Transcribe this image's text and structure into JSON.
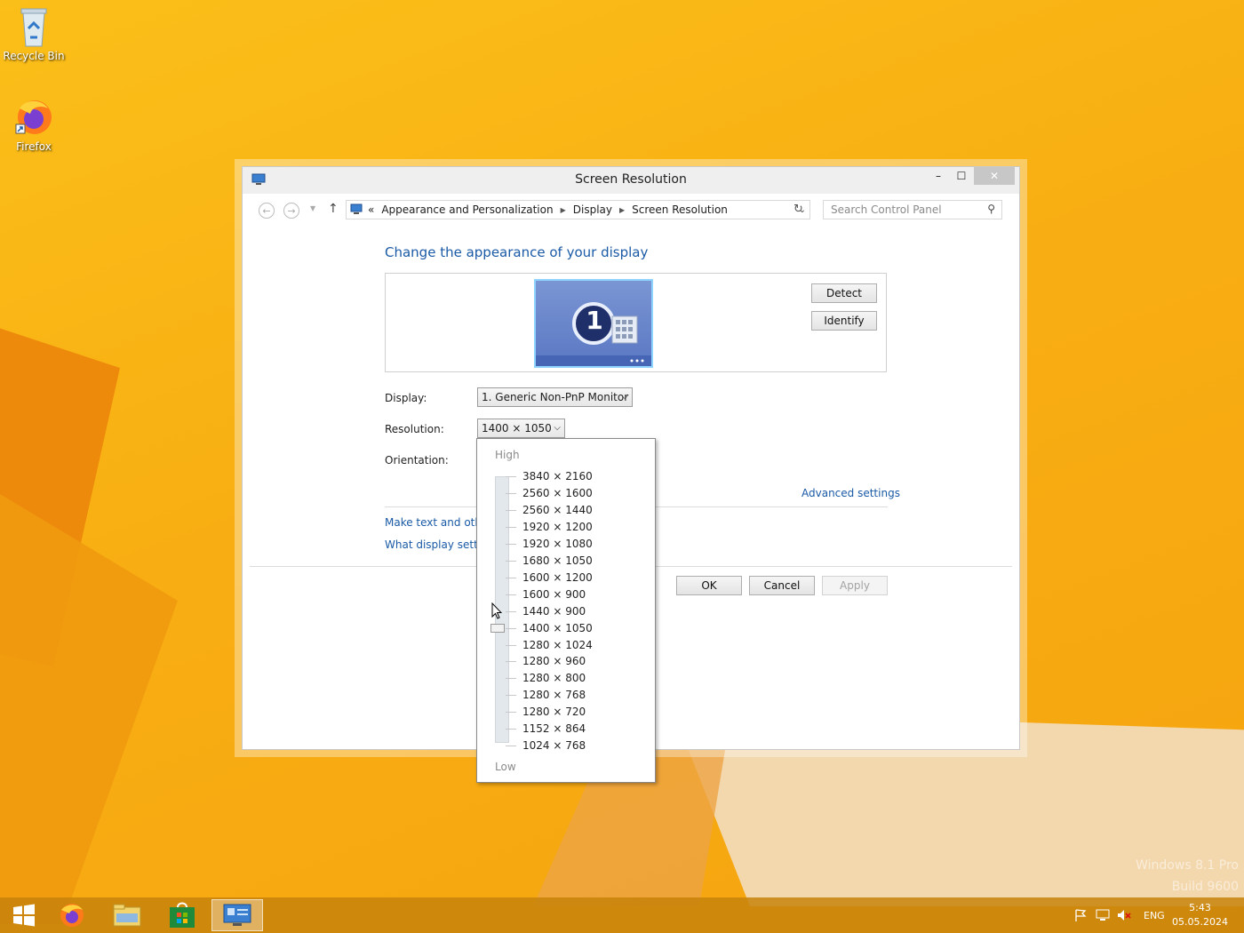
{
  "desktop": {
    "icons": [
      {
        "name": "recycle-bin",
        "label": "Recycle Bin"
      },
      {
        "name": "firefox",
        "label": "Firefox"
      }
    ],
    "watermark": {
      "line1": "Windows 8.1 Pro",
      "line2": "Build 9600"
    }
  },
  "window": {
    "title": "Screen Resolution",
    "controls": {
      "minimize": "–",
      "maximize": "☐",
      "close": "✕"
    }
  },
  "navigation": {
    "breadcrumb_prefix": "«",
    "breadcrumb": [
      "Appearance and Personalization",
      "Display",
      "Screen Resolution"
    ],
    "search_placeholder": "Search Control Panel"
  },
  "main": {
    "heading": "Change the appearance of your display",
    "monitor_number": "1",
    "detect_label": "Detect",
    "identify_label": "Identify",
    "display_label": "Display:",
    "display_value": "1. Generic Non-PnP Monitor",
    "resolution_label": "Resolution:",
    "resolution_value": "1400 × 1050",
    "orientation_label": "Orientation:",
    "advanced_link": "Advanced settings",
    "link_text_size": "Make text and other",
    "link_what_settings": "What display setting",
    "ok_label": "OK",
    "cancel_label": "Cancel",
    "apply_label": "Apply"
  },
  "resolution_dropdown": {
    "high_label": "High",
    "low_label": "Low",
    "options": [
      "3840 × 2160",
      "2560 × 1600",
      "2560 × 1440",
      "1920 × 1200",
      "1920 × 1080",
      "1680 × 1050",
      "1600 × 1200",
      "1600 × 900",
      "1440 × 900",
      "1400 × 1050",
      "1280 × 1024",
      "1280 × 960",
      "1280 × 800",
      "1280 × 768",
      "1280 × 720",
      "1152 × 864",
      "1024 × 768"
    ],
    "selected_index": 9
  },
  "taskbar": {
    "language": "ENG",
    "time": "5:43",
    "date": "05.05.2024"
  }
}
